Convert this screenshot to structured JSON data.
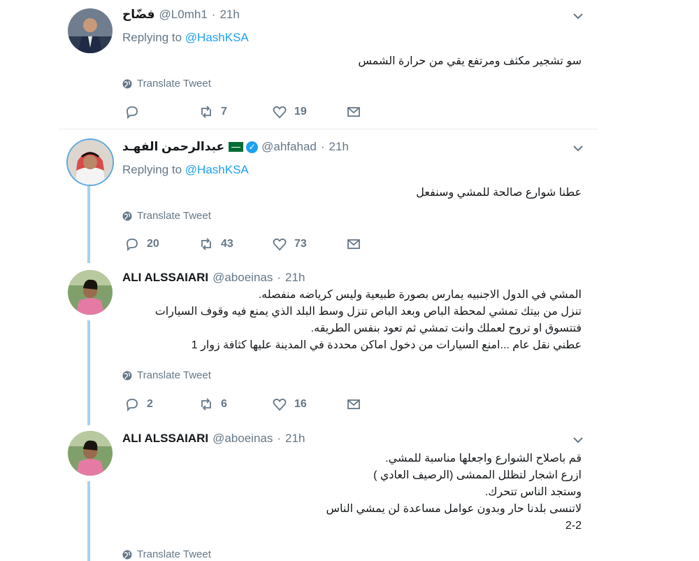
{
  "tweets": [
    {
      "name": "فضّاح",
      "handle": "@L0mh1",
      "time": "21h",
      "replying_prefix": "Replying to",
      "replying_to": "@HashKSA",
      "text": "سو تشجير مكثف ومرتفع يقي من حرارة الشمس",
      "translate": "Translate Tweet",
      "replies": "",
      "retweets": "7",
      "likes": "19"
    },
    {
      "name": "عبدالرحمن الفهـد",
      "handle": "@ahfahad",
      "time": "21h",
      "replying_prefix": "Replying to",
      "replying_to": "@HashKSA",
      "text": "عطنا شوارع صالحة للمشي وسنفعل",
      "translate": "Translate Tweet",
      "replies": "20",
      "retweets": "43",
      "likes": "73"
    },
    {
      "name": "ALI ALSSAIARI",
      "handle": "@aboeinas",
      "time": "21h",
      "text": "المشي في الدول الاجنبيه يمارس بصورة طبيعية وليس كرياضه منفصله.\nتنزل من بيتك تمشي لمحطة الباص وبعد الباص تنزل وسط البلد الذي يمنع فيه وقوف السيارات فتتسوق او تروح لعملك وانت تمشي ثم تعود بنفس الطريقه.\nعطني نقل عام ...امنع السيارات من دخول اماكن محددة في المدينة عليها كثافة زوار  1",
      "translate": "Translate Tweet",
      "replies": "2",
      "retweets": "6",
      "likes": "16"
    },
    {
      "name": "ALI ALSSAIARI",
      "handle": "@aboeinas",
      "time": "21h",
      "text": "قم باصلاح الشوارع واجعلها مناسبة للمشي.\nازرع اشجار لتظلل الممشى (الرصيف العادي )\nوستجد الناس تتحرك.\nلاتنسى بلدنا حار وبدون عوامل مساعدة لن يمشي الناس\n2-2",
      "translate": "Translate Tweet"
    }
  ],
  "colors": {
    "accent": "#1da1f2",
    "secondary_text": "#657786",
    "thread_line": "#a6d1f0",
    "verified": "#1da1f2"
  },
  "icons": [
    "reply-icon",
    "retweet-icon",
    "like-icon",
    "dm-icon",
    "globe-icon",
    "caret-down-icon",
    "verified-badge-icon",
    "saudi-flag-icon"
  ]
}
